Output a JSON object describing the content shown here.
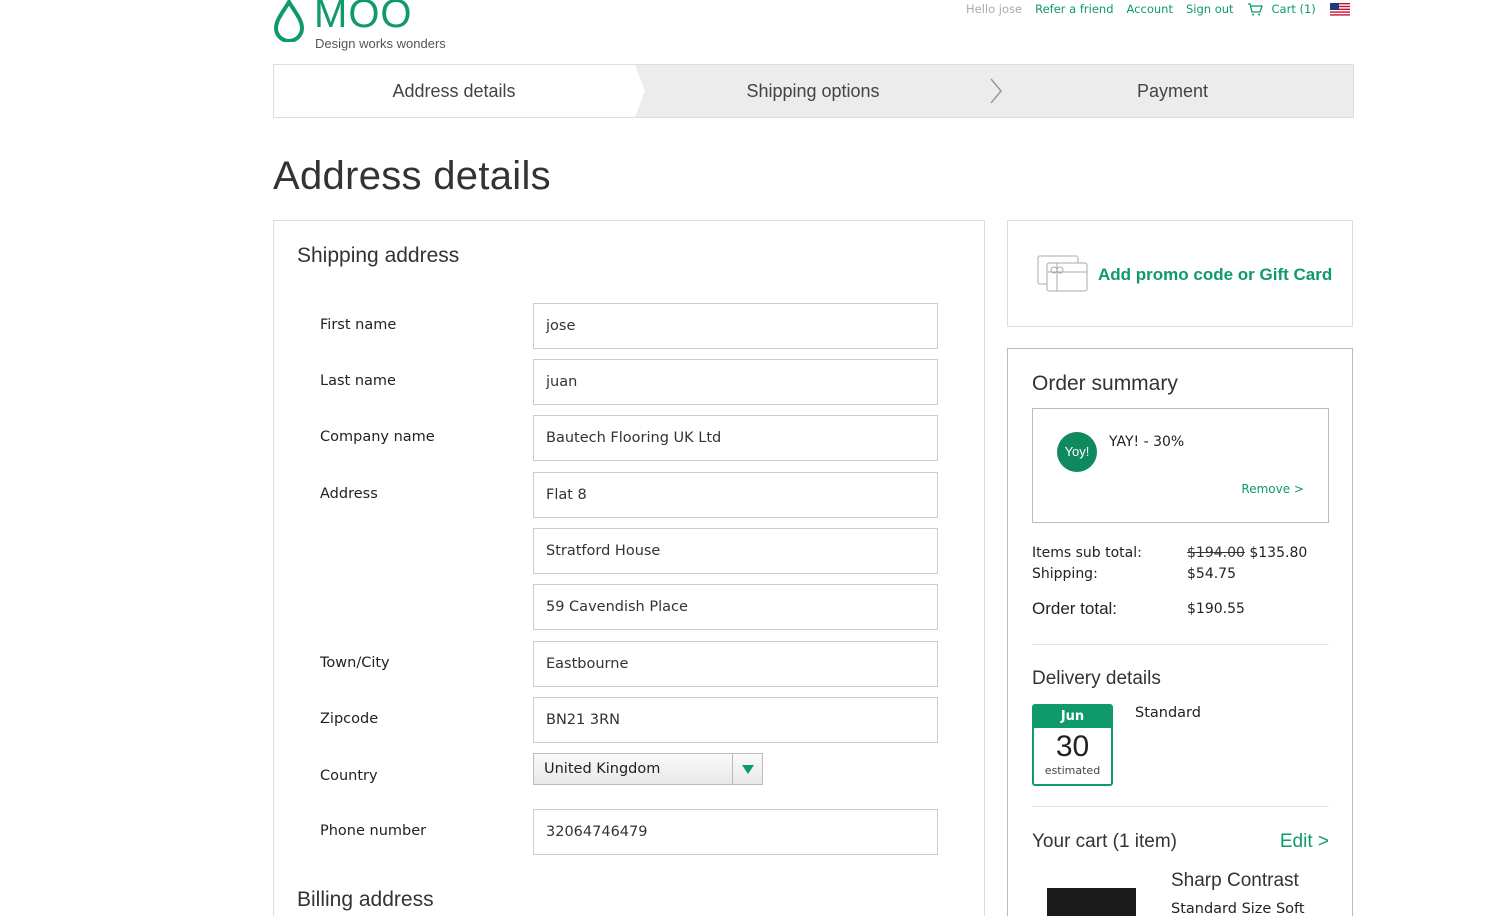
{
  "brand": {
    "name": "MOO",
    "tagline": "Design works wonders",
    "color": "#0e9a6a"
  },
  "topnav": {
    "greeting": "Hello jose",
    "refer": "Refer a friend",
    "account": "Account",
    "sign_out": "Sign out",
    "cart": "Cart (1)",
    "flag": "us-flag-icon"
  },
  "steps": [
    "Address details",
    "Shipping options",
    "Payment"
  ],
  "page_title": "Address details",
  "shipping": {
    "title": "Shipping address",
    "labels": {
      "first_name": "First name",
      "last_name": "Last name",
      "company": "Company name",
      "address": "Address",
      "town": "Town/City",
      "zip": "Zipcode",
      "country": "Country",
      "phone": "Phone number"
    },
    "values": {
      "first_name": "jose",
      "last_name": "juan",
      "company": "Bautech Flooring UK Ltd",
      "address1": "Flat 8",
      "address2": "Stratford House",
      "address3": "59 Cavendish Place",
      "town": "Eastbourne",
      "zip": "BN21 3RN",
      "country": "United Kingdom",
      "phone": "32064746479"
    }
  },
  "billing": {
    "title": "Billing address"
  },
  "promo": {
    "label": "Add promo code or Gift Card"
  },
  "summary": {
    "title": "Order summary",
    "discount": {
      "badge": "Yoy!",
      "text": "YAY! - 30%",
      "remove": "Remove >"
    },
    "items_label": "Items sub total:",
    "items_old": "$194.00",
    "items_new": "$135.80",
    "shipping_label": "Shipping:",
    "shipping_value": "$54.75",
    "total_label": "Order total:",
    "total_value": "$190.55",
    "delivery": {
      "title": "Delivery details",
      "month": "Jun",
      "day": "30",
      "estimated": "estimated",
      "type": "Standard"
    },
    "cart": {
      "title": "Your cart (1 item)",
      "edit": "Edit >",
      "item_name": "Sharp Contrast",
      "item_sub": "Standard Size Soft"
    }
  }
}
